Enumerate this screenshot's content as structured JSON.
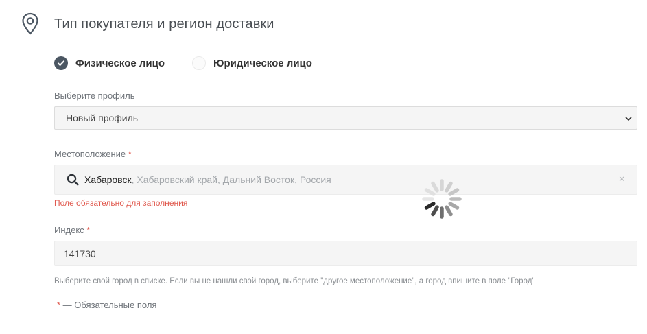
{
  "section": {
    "title": "Тип покупателя и регион доставки",
    "icon": "location-pin-icon"
  },
  "buyer_type": {
    "options": [
      {
        "label": "Физическое лицо",
        "checked": true
      },
      {
        "label": "Юридическое лицо",
        "checked": false
      }
    ]
  },
  "profile": {
    "label": "Выберите профиль",
    "selected": "Новый профиль"
  },
  "location": {
    "label": "Местоположение",
    "required_mark": "*",
    "city": "Хабаровск",
    "details": ", Хабаровский край, Дальний Восток, Россия",
    "clear_glyph": "×",
    "error": "Поле обязательно для заполнения"
  },
  "postal_index": {
    "label": "Индекс",
    "required_mark": "*",
    "value": "141730"
  },
  "hint": "Выберите свой город в списке. Если вы не нашли свой город, выберите \"другое местоположение\", а город впишите в поле \"Город\"",
  "legend": {
    "mark": "*",
    "text": " — Обязательные поля"
  },
  "colors": {
    "accent": "#4b5662",
    "error": "#e05a4f",
    "field_bg": "#f5f5f5"
  }
}
